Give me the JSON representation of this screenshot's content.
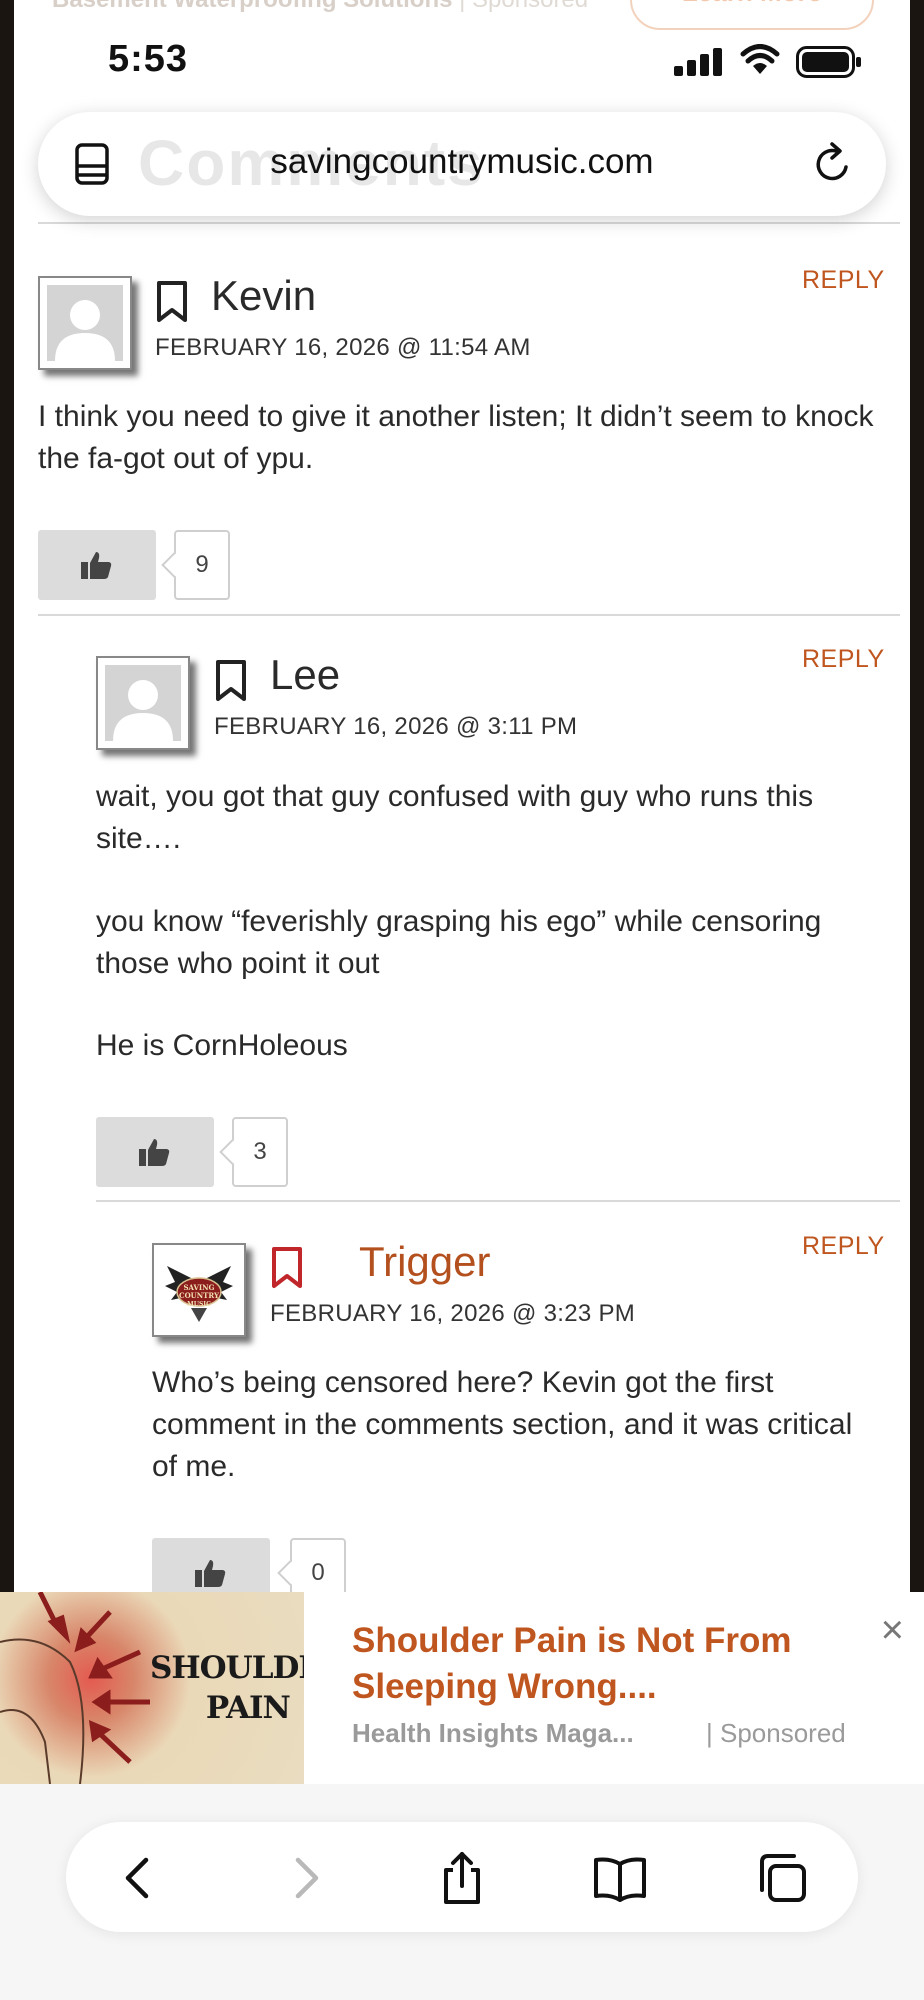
{
  "top_ad": {
    "text": "Basement Waterproofing Solutions",
    "sponsored": "| Sponsored",
    "button": "Learn More"
  },
  "status_bar": {
    "time": "5:53",
    "icons": [
      "signal-icon",
      "wifi-icon",
      "battery-icon"
    ]
  },
  "address_bar": {
    "url": "savingcountrymusic.com",
    "ghost_heading": "Comments"
  },
  "comments": [
    {
      "author": "Kevin",
      "date": "FEBRUARY 16, 2026 @ 11:54 AM",
      "reply": "REPLY",
      "body": [
        "I think you need to give it another listen; It didn’t seem to knock the fa-got out of ypu."
      ],
      "likes": "9"
    },
    {
      "author": "Lee",
      "date": "FEBRUARY 16, 2026 @ 3:11 PM",
      "reply": "REPLY",
      "body": [
        "wait, you got that guy confused with guy who runs this site….",
        "you know “feverishly grasping his ego” while censoring those who point it out",
        "He is CornHoleous"
      ],
      "likes": "3"
    },
    {
      "author": "Trigger",
      "date": "FEBRUARY 16, 2026 @ 3:23 PM",
      "reply": "REPLY",
      "body": [
        "Who’s being censored here? Kevin got the first comment in the comments section, and it was critical of me."
      ],
      "likes": "0",
      "avatar_text": "SAVING COUNTRY MUSIC"
    }
  ],
  "bottom_ad": {
    "image_text": "SHOULDER PAIN",
    "title": "Shoulder Pain is Not From Sleeping Wrong....",
    "source": "Health Insights Maga...",
    "sponsored": "| Sponsored",
    "close": "×"
  },
  "toolbar": {
    "buttons": [
      "back-icon",
      "forward-icon",
      "share-icon",
      "bookmarks-icon",
      "tabs-icon"
    ]
  },
  "colors": {
    "accent": "#c0561f",
    "bookmark_author": "#c0262a"
  }
}
